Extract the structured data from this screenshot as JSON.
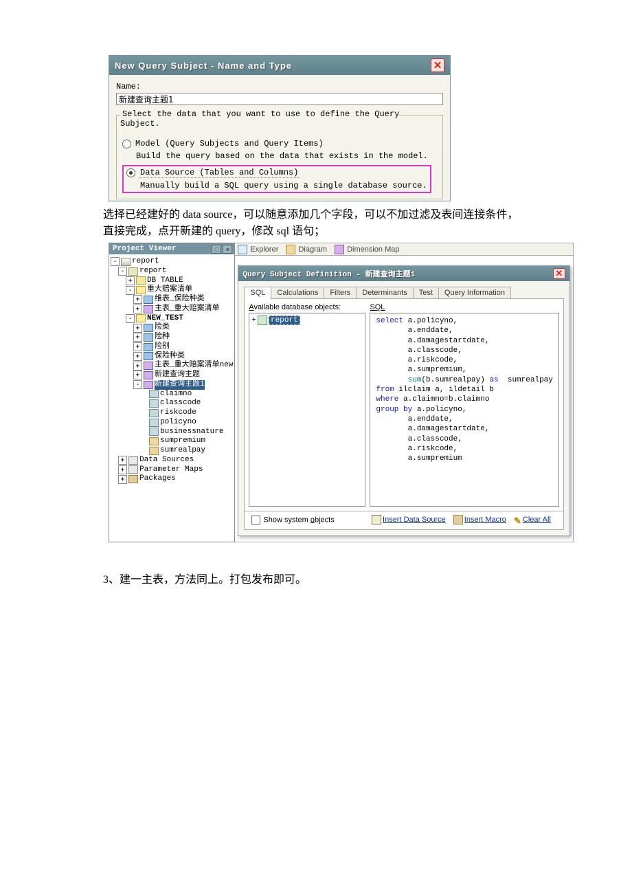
{
  "dialog1": {
    "title": "New Query Subject - Name and Type",
    "name_label": "Name:",
    "name_value": "新建查询主题1",
    "group_title": "Select the data that you want to use to define the Query Subject.",
    "opt_model": "Model (Query Subjects and Query Items)",
    "opt_model_desc": "Build the query based on the data that exists in the model.",
    "opt_ds": "Data Source (Tables and Columns)",
    "opt_ds_desc": "Manually build a SQL query using a single database source."
  },
  "para1": "选择已经建好的 data source，可以随意添加几个字段，可以不加过滤及表间连接条件，直接完成，点开新建的 query，修改 sql 语句；",
  "pv": {
    "title": "Project Viewer",
    "node_report": "report",
    "node_report2": "report",
    "db_table": "DB TABLE",
    "big_folder": "重大赔案清单",
    "wb_class": "维表_保险种类",
    "zb_big": "主表_重大赔案清单",
    "new_test": "NEW_TEST",
    "xianlei": "险类",
    "xianzhong": "险种",
    "xianbie": "险别",
    "bx_class": "保险种类",
    "zb_new": "主表_重大赔案清单new",
    "new_qs": "新建查询主题",
    "new_qs1": "新建查询主题1",
    "qi": {
      "claimno": "claimno",
      "classcode": "classcode",
      "riskcode": "riskcode",
      "policyno": "policyno",
      "businessnature": "businessnature",
      "sumpremium": "sumpremium",
      "sumrealpay": "sumrealpay"
    },
    "data_sources": "Data Sources",
    "parameter_maps": "Parameter Maps",
    "packages": "Packages"
  },
  "viewtabs": {
    "explorer": "Explorer",
    "diagram": "Diagram",
    "dimmap": "Dimension Map"
  },
  "qsd": {
    "title": "Query Subject Definition - 新建查询主题1",
    "tabs": {
      "sql": "SQL",
      "calc": "Calculations",
      "filters": "Filters",
      "det": "Determinants",
      "test": "Test",
      "qinfo": "Query Information"
    },
    "ado_label": "Available database objects:",
    "ado_root": "report",
    "sql_label": "SQL",
    "sql": {
      "l1": "select",
      "l1b": " a.policyno,",
      "l2": "       a.enddate,",
      "l3": "       a.damagestartdate,",
      "l4": "       a.classcode,",
      "l5": "       a.riskcode,",
      "l6": "       a.sumpremium,",
      "l7a": "       sum",
      "l7b": "(b.sumrealpay) ",
      "l7c": "as",
      "l7d": "  sumrealpay",
      "l8a": "from",
      "l8b": " ilclaim a, ildetail b",
      "l9a": "where",
      "l9b": " a.claimno=b.claimno",
      "l10a": "group by",
      "l10b": " a.policyno,",
      "l11": "       a.enddate,",
      "l12": "       a.damagestartdate,",
      "l13": "       a.classcode,",
      "l14": "       a.riskcode,",
      "l15": "       a.sumpremium"
    },
    "show_sys": "Show system objects",
    "links": {
      "insert_ds": "Insert Data Source",
      "insert_macro": "Insert Macro",
      "clear_all": "Clear All"
    }
  },
  "para2": "3、建一主表，方法同上。打包发布即可。"
}
